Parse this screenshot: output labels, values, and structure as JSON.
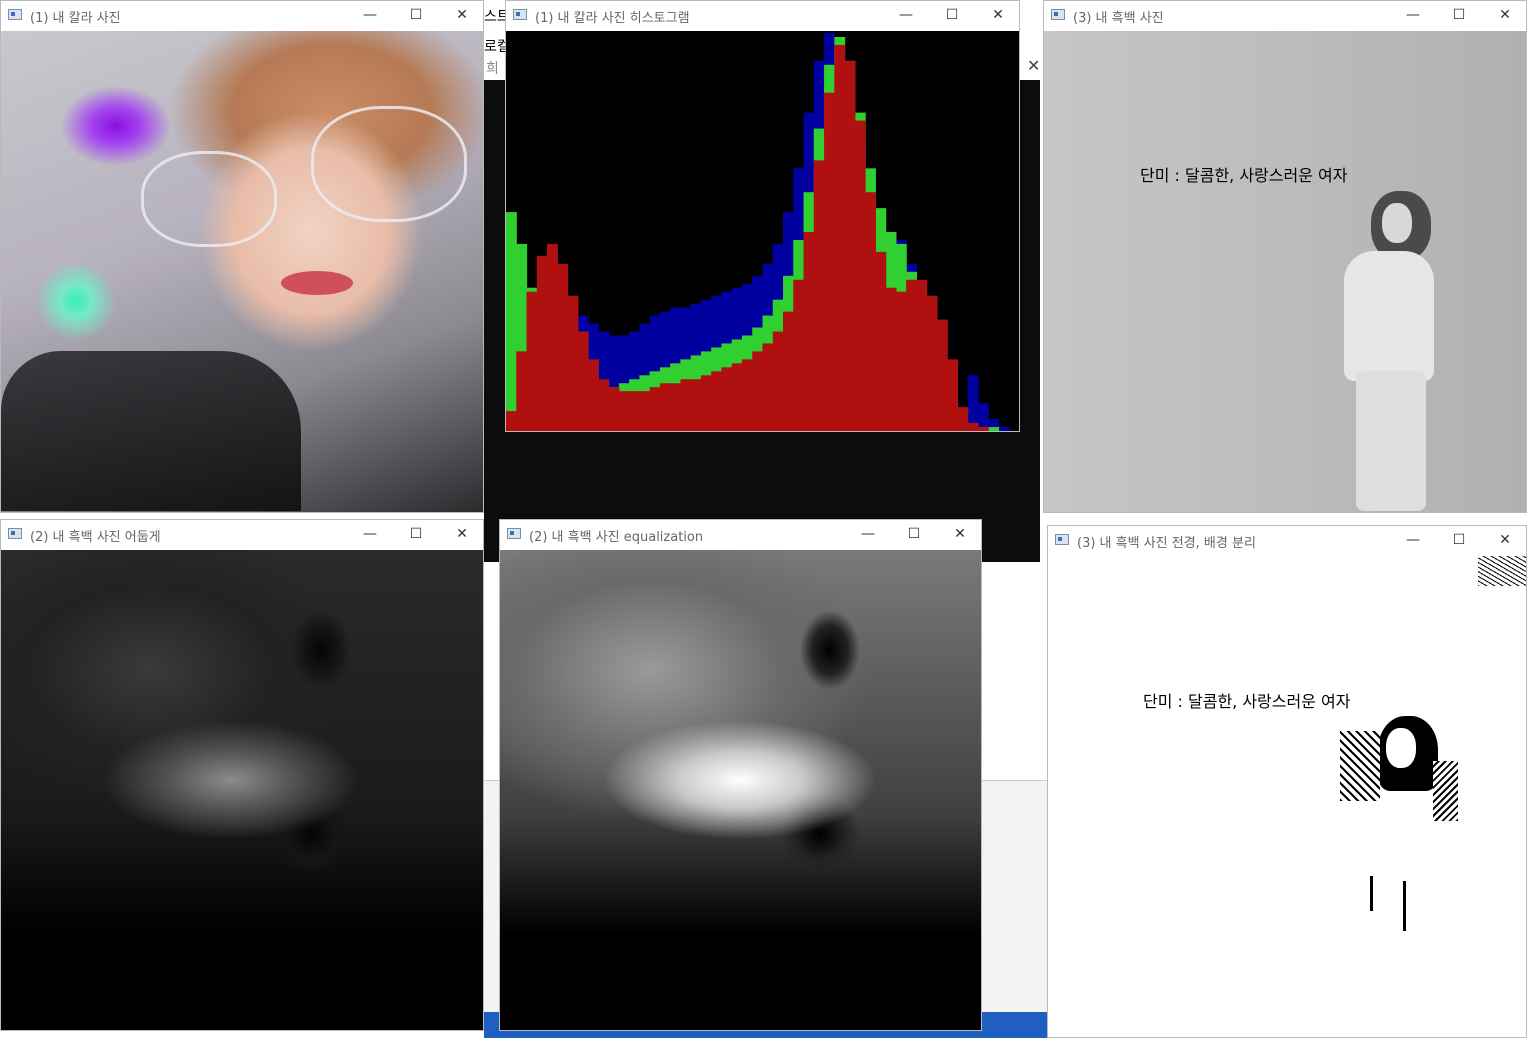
{
  "windows": {
    "color_photo": {
      "title": "(1) 내 칼라 사진"
    },
    "histogram": {
      "title": "(1) 내 칼라 사진 히스토그램"
    },
    "gray_photo": {
      "title": "(3) 내 흑백 사진",
      "overlay_text": "단미 : 달콤한, 사랑스러운 여자"
    },
    "dark_photo": {
      "title": "(2) 내 흑백 사진 어둡게"
    },
    "equalized_photo": {
      "title": "(2) 내 흑백 사진 equalization"
    },
    "segmented_photo": {
      "title": "(3) 내 흑백 사진 전경, 배경 분리",
      "overlay_text": "단미 : 달콤한, 사랑스러운 여자"
    }
  },
  "controls": {
    "minimize": "—",
    "maximize": "☐",
    "close": "✕"
  },
  "background_app": {
    "fragments": [
      "스트",
      "로컬",
      "희"
    ]
  },
  "chart_data": {
    "type": "area",
    "title": "",
    "channels": [
      {
        "name": "",
        "color": "#0000a0",
        "values": [
          0.23,
          0.27,
          0.3,
          0.32,
          0.34,
          0.33,
          0.31,
          0.29,
          0.27,
          0.25,
          0.24,
          0.24,
          0.25,
          0.27,
          0.29,
          0.3,
          0.31,
          0.31,
          0.32,
          0.33,
          0.34,
          0.35,
          0.36,
          0.37,
          0.39,
          0.42,
          0.47,
          0.55,
          0.66,
          0.8,
          0.93,
          1.0,
          0.97,
          0.86,
          0.72,
          0.6,
          0.52,
          0.49,
          0.48,
          0.42,
          0.33,
          0.24,
          0.14,
          0.06,
          0.02,
          0.14,
          0.07,
          0.03,
          0.01,
          0.0
        ]
      },
      {
        "name": "",
        "color": "#30d030",
        "values": [
          0.55,
          0.47,
          0.36,
          0.26,
          0.18,
          0.12,
          0.1,
          0.09,
          0.09,
          0.1,
          0.11,
          0.12,
          0.13,
          0.14,
          0.15,
          0.16,
          0.17,
          0.18,
          0.19,
          0.2,
          0.21,
          0.22,
          0.23,
          0.24,
          0.26,
          0.29,
          0.33,
          0.39,
          0.48,
          0.6,
          0.76,
          0.92,
          0.99,
          0.93,
          0.8,
          0.66,
          0.56,
          0.5,
          0.47,
          0.4,
          0.3,
          0.2,
          0.1,
          0.04,
          0.01,
          0.02,
          0.01,
          0.01,
          0.0,
          0.0
        ]
      },
      {
        "name": "",
        "color": "#b01010",
        "values": [
          0.05,
          0.2,
          0.35,
          0.44,
          0.47,
          0.42,
          0.34,
          0.25,
          0.18,
          0.13,
          0.11,
          0.1,
          0.1,
          0.1,
          0.11,
          0.12,
          0.12,
          0.13,
          0.13,
          0.14,
          0.15,
          0.16,
          0.17,
          0.18,
          0.2,
          0.22,
          0.25,
          0.3,
          0.38,
          0.5,
          0.68,
          0.85,
          0.97,
          0.93,
          0.78,
          0.6,
          0.45,
          0.36,
          0.35,
          0.38,
          0.38,
          0.34,
          0.28,
          0.18,
          0.06,
          0.02,
          0.01,
          0.0,
          0.0,
          0.0
        ]
      }
    ],
    "x_range": [
      0,
      255
    ],
    "y_range": [
      0,
      1
    ]
  }
}
